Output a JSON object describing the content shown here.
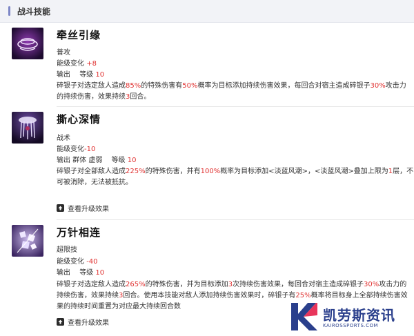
{
  "header": {
    "title": "战斗技能"
  },
  "skills": [
    {
      "name": "牵丝引缘",
      "type": "普攻",
      "energy_label": "能级变化",
      "energy_value": "+8",
      "tags": "输出",
      "level_label": "等级",
      "level_value": "10",
      "desc": [
        [
          "碎银子对选定敌人造成",
          ""
        ],
        [
          "85%",
          "red"
        ],
        [
          "的特殊伤害有",
          ""
        ],
        [
          "50%",
          "red"
        ],
        [
          "概率为目标添加持续伤害效果，每回合对宿主造成碎银子",
          ""
        ],
        [
          "30%",
          "red"
        ],
        [
          "攻击力",
          ""
        ]
      ],
      "desc2": [
        [
          "的持续伤害，效果持续",
          ""
        ],
        [
          "3",
          "red"
        ],
        [
          "回合。",
          ""
        ]
      ]
    },
    {
      "name": "撕心深情",
      "type": "战术",
      "energy_label": "能级变化",
      "energy_value": "-10",
      "tags": "输出 群体 虚弱",
      "level_label": "等级",
      "level_value": "10",
      "desc": [
        [
          "碎银子对全部敌人造成",
          ""
        ],
        [
          "225%",
          "red"
        ],
        [
          "的特殊伤害，并有",
          ""
        ],
        [
          "100%",
          "red"
        ],
        [
          "概率为目标添加<淡蓝风潮>，<淡蓝风潮>叠加上限为",
          ""
        ],
        [
          "1",
          "red"
        ],
        [
          "层，不",
          ""
        ]
      ],
      "desc2": [
        [
          "可被消除，无法被抵抗。",
          ""
        ]
      ],
      "upgrade": "查看升级效果"
    },
    {
      "name": "万针相连",
      "type": "超限技",
      "energy_label": "能级变化",
      "energy_value": "-40",
      "tags": "输出",
      "level_label": "等级",
      "level_value": "10",
      "desc": [
        [
          "碎银子对选定敌人造成",
          ""
        ],
        [
          "265%",
          "red"
        ],
        [
          "的特殊伤害，并为目标添加",
          ""
        ],
        [
          "3",
          "red"
        ],
        [
          "次持续伤害效果，每回合对宿主造成碎银子",
          ""
        ],
        [
          "30%",
          "red"
        ],
        [
          "攻击力的",
          ""
        ]
      ],
      "desc2": [
        [
          "持续伤害，效果持续",
          ""
        ],
        [
          "3",
          "red"
        ],
        [
          "回合。使用本技能对敌人添加持续伤害效果时，碎银子有",
          ""
        ],
        [
          "25%",
          "red"
        ],
        [
          "概率将目标身上全部持续伤害效",
          ""
        ]
      ],
      "desc3": [
        [
          "果的持续时间重置为对应最大持续回合数",
          ""
        ]
      ],
      "upgrade": "查看升级效果"
    }
  ],
  "watermark": {
    "text": "凯劳斯资讯",
    "sub": "KAIROSSPORTS.COM"
  },
  "colors": {
    "accent_red": "#e0302f",
    "header_bar": "#7d86c6",
    "watermark_blue": "#2a3f8c"
  }
}
